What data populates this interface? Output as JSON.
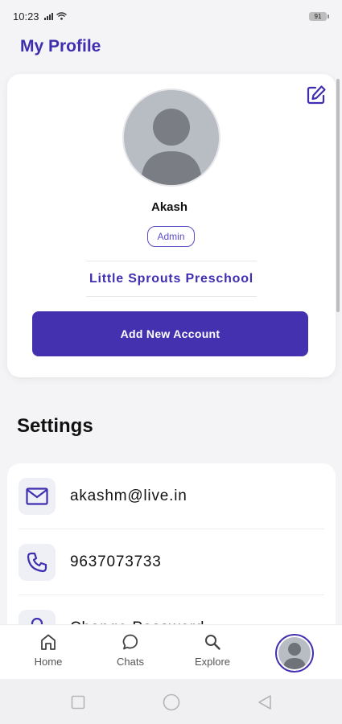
{
  "status_bar": {
    "time": "10:23",
    "battery": "91"
  },
  "page": {
    "title": "My Profile"
  },
  "profile": {
    "name": "Akash",
    "role": "Admin",
    "school": "Little Sprouts Preschool",
    "add_account_label": "Add New Account",
    "edit_icon": "edit-icon"
  },
  "settings": {
    "title": "Settings",
    "items": [
      {
        "icon": "mail-icon",
        "label": "akashm@live.in"
      },
      {
        "icon": "phone-icon",
        "label": "9637073733"
      },
      {
        "icon": "lock-icon",
        "label": "Change Password"
      }
    ]
  },
  "bottom_nav": {
    "items": [
      {
        "icon": "home-icon",
        "label": "Home"
      },
      {
        "icon": "chat-icon",
        "label": "Chats"
      },
      {
        "icon": "search-icon",
        "label": "Explore"
      },
      {
        "icon": "avatar",
        "label": ""
      }
    ]
  },
  "colors": {
    "accent": "#4431b0",
    "title": "#3f2fb0",
    "background": "#f4f4f6"
  }
}
